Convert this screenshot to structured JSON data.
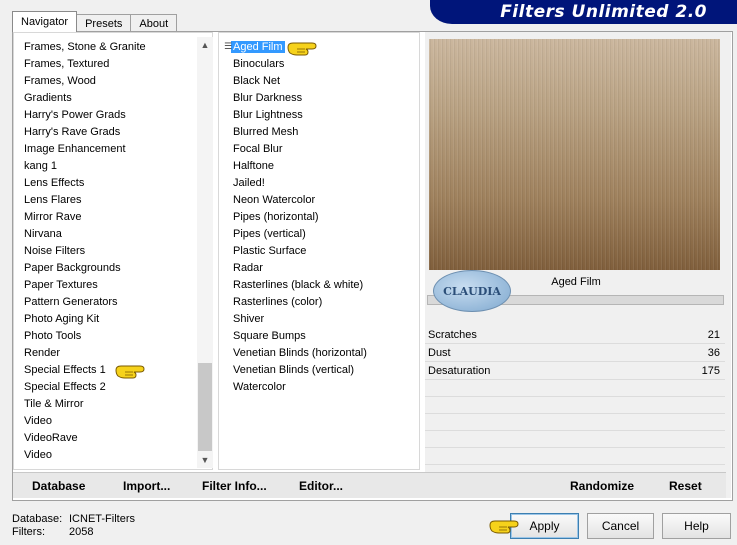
{
  "app_title": "Filters Unlimited 2.0",
  "tabs": [
    {
      "label": "Navigator",
      "active": true
    },
    {
      "label": "Presets",
      "active": false
    },
    {
      "label": "About",
      "active": false
    }
  ],
  "categories": [
    "Frames, Stone & Granite",
    "Frames, Textured",
    "Frames, Wood",
    "Gradients",
    "Harry's Power Grads",
    "Harry's Rave Grads",
    "Image Enhancement",
    "kang 1",
    "Lens Effects",
    "Lens Flares",
    "Mirror Rave",
    "Nirvana",
    "Noise Filters",
    "Paper Backgrounds",
    "Paper Textures",
    "Pattern Generators",
    "Photo Aging Kit",
    "Photo Tools",
    "Render",
    "Special Effects 1",
    "Special Effects 2",
    "Tile & Mirror",
    "Video",
    "VideoRave",
    "Video"
  ],
  "filters": [
    "Aged Film",
    "Binoculars",
    "Black Net",
    "Blur Darkness",
    "Blur Lightness",
    "Blurred Mesh",
    "Focal Blur",
    "Halftone",
    "Jailed!",
    "Neon Watercolor",
    "Pipes (horizontal)",
    "Pipes (vertical)",
    "Plastic Surface",
    "Radar",
    "Rasterlines (black & white)",
    "Rasterlines (color)",
    "Shiver",
    "Square Bumps",
    "Venetian Blinds (horizontal)",
    "Venetian Blinds (vertical)",
    "Watercolor"
  ],
  "selected_filter": "Aged Film",
  "preview": {
    "filter_name": "Aged Film",
    "watermark": "CLAUDIA"
  },
  "params": [
    {
      "label": "Scratches",
      "value": "21"
    },
    {
      "label": "Dust",
      "value": "36"
    },
    {
      "label": "Desaturation",
      "value": "175"
    }
  ],
  "bottom_links": {
    "database": "Database",
    "import": "Import...",
    "filter_info": "Filter Info...",
    "editor": "Editor...",
    "randomize": "Randomize",
    "reset": "Reset"
  },
  "footer": {
    "database_label": "Database:",
    "database_value": "ICNET-Filters",
    "filters_label": "Filters:",
    "filters_value": "2058"
  },
  "buttons": {
    "apply": "Apply",
    "cancel": "Cancel",
    "help": "Help"
  },
  "icons": {
    "pointer": "pointing-hand-icon",
    "scroll_up": "chevron-up-icon",
    "scroll_down": "chevron-down-icon"
  }
}
